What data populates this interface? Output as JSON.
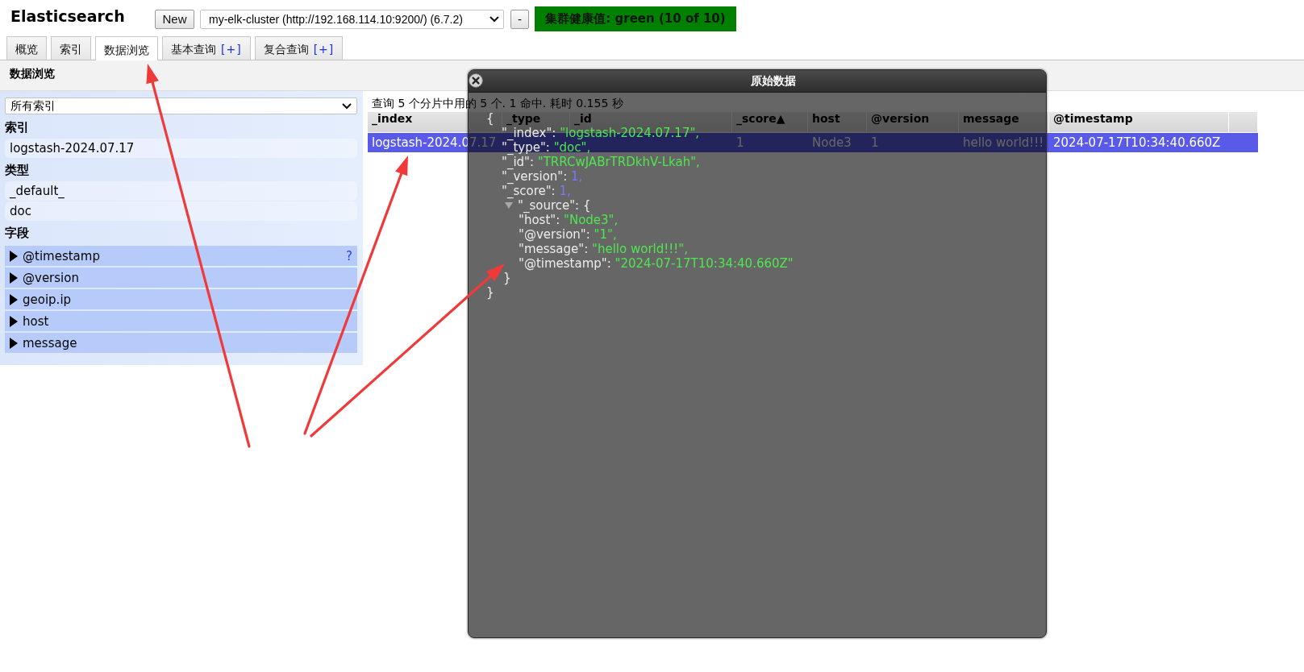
{
  "header": {
    "title": "Elasticsearch",
    "new_button": "New",
    "cluster_select": {
      "value": "my-elk-cluster (http://192.168.114.10:9200/) (6.7.2)"
    },
    "disconnect_button": "-",
    "health": {
      "label": "集群健康值: green (10 of 10)",
      "color": "#008000"
    }
  },
  "tabs": [
    {
      "label": "概览",
      "selected": false
    },
    {
      "label": "索引",
      "selected": false
    },
    {
      "label": "数据浏览",
      "selected": true
    },
    {
      "label": "基本查询",
      "add": "[+]",
      "selected": false
    },
    {
      "label": "复合查询",
      "add": "[+]",
      "selected": false
    }
  ],
  "section_title": "数据浏览",
  "sidebar": {
    "index_select": {
      "value": "所有索引"
    },
    "groups": [
      {
        "title": "索引",
        "kind": "filter",
        "items": [
          {
            "label": "logstash-2024.07.17",
            "selected": false
          }
        ]
      },
      {
        "title": "类型",
        "kind": "filter",
        "items": [
          {
            "label": "_default_",
            "selected": false
          },
          {
            "label": "doc",
            "selected": false
          }
        ]
      },
      {
        "title": "字段",
        "kind": "field",
        "items": [
          {
            "label": "@timestamp",
            "expanded": false,
            "help": "?"
          },
          {
            "label": "@version",
            "expanded": false
          },
          {
            "label": "geoip.ip",
            "expanded": false
          },
          {
            "label": "host",
            "expanded": false
          },
          {
            "label": "message",
            "expanded": false
          }
        ]
      }
    ]
  },
  "results": {
    "summary": "查询 5 个分片中用的 5 个. 1 命中. 耗时 0.155 秒",
    "columns": [
      {
        "kind": "heading",
        "label": "_index"
      },
      {
        "kind": "heading",
        "label": "_type"
      },
      {
        "kind": "heading",
        "label": "_id"
      },
      {
        "kind": "heading",
        "label": "_score",
        "sort": "▲"
      },
      {
        "kind": "heading",
        "label": "host"
      },
      {
        "kind": "heading",
        "label": "@version"
      },
      {
        "kind": "heading",
        "label": "message"
      },
      {
        "kind": "heading",
        "label": "@timestamp"
      }
    ],
    "rows": [
      {
        "selected": true,
        "cells": [
          {
            "kind": "text",
            "text": "logstash-2024.07.17"
          },
          {
            "kind": "covered"
          },
          {
            "kind": "covered"
          },
          {
            "kind": "text",
            "text": "1"
          },
          {
            "kind": "text",
            "text": "Node3"
          },
          {
            "kind": "text",
            "text": "1"
          },
          {
            "kind": "text",
            "text": "hello world!!!"
          },
          {
            "kind": "text",
            "text": "2024-07-17T10:34:40.660Z"
          }
        ]
      }
    ]
  },
  "raw_dialog": {
    "title": "原始数据",
    "open": "{",
    "fields": [
      {
        "kind": "string",
        "key": "\"_index\":",
        "value": "\"logstash-2024.07.17\"",
        "tail": ","
      },
      {
        "kind": "string",
        "key": "\"_type\":",
        "value": "\"doc\"",
        "tail": ","
      },
      {
        "kind": "string",
        "key": "\"_id\":",
        "value": "\"TRRCwJABrTRDkhV-Lkah\"",
        "tail": ","
      },
      {
        "kind": "number",
        "key": "\"_version\":",
        "value": "1",
        "tail": ","
      },
      {
        "kind": "number",
        "key": "\"_score\":",
        "value": "1",
        "tail": ","
      },
      {
        "kind": "object",
        "key": "\"_source\":",
        "open": "{",
        "expanded": true,
        "children": [
          {
            "kind": "string",
            "key": "\"host\":",
            "value": "\"Node3\"",
            "tail": ","
          },
          {
            "kind": "string",
            "key": "\"@version\":",
            "value": "\"1\"",
            "tail": ","
          },
          {
            "kind": "string",
            "key": "\"message\":",
            "value": "\"hello world!!!\"",
            "tail": ","
          },
          {
            "kind": "string",
            "key": "\"@timestamp\":",
            "value": "\"2024-07-17T10:34:40.660Z\""
          }
        ],
        "close": "}"
      }
    ],
    "close": "}"
  },
  "annotations": [
    {
      "kind": "arrow"
    },
    {
      "kind": "arrow"
    },
    {
      "kind": "arrow"
    }
  ]
}
